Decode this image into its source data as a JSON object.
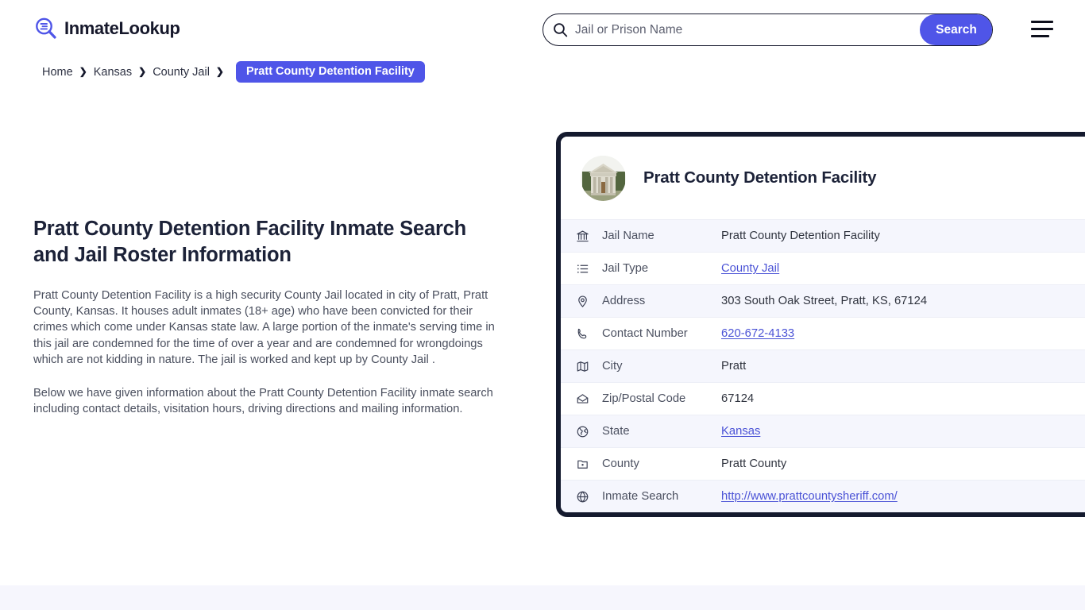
{
  "header": {
    "logo_text": "InmateLookup",
    "logo_icon": "magnifier-list-icon",
    "search_placeholder": "Jail or Prison Name",
    "search_value": "",
    "search_button_label": "Search",
    "search_icon": "search-icon",
    "menu_icon": "hamburger-menu-icon"
  },
  "breadcrumb": {
    "items": [
      {
        "label": "Home"
      },
      {
        "label": "Kansas"
      },
      {
        "label": "County Jail"
      }
    ],
    "separator": "❯",
    "current": "Pratt County Detention Facility"
  },
  "main": {
    "title": "Pratt County Detention Facility Inmate Search and Jail Roster Information",
    "paragraph_1": "Pratt County Detention Facility is a high security County Jail located in city of Pratt, Pratt County, Kansas. It houses adult inmates (18+ age) who have been convicted for their crimes which come under Kansas state law. A large portion of the inmate's serving time in this jail are condemned for the time of over a year and are condemned for wrongdoings which are not kidding in nature. The jail is worked and kept up by County Jail .",
    "paragraph_2": "Below we have given information about the Pratt County Detention Facility inmate search including contact details, visitation hours, driving directions and mailing information."
  },
  "info_card": {
    "avatar_icon": "courthouse-photo",
    "title": "Pratt County Detention Facility",
    "rows": [
      {
        "icon": "bank-icon",
        "label": "Jail Name",
        "value": "Pratt County Detention Facility",
        "link": false
      },
      {
        "icon": "list-icon",
        "label": "Jail Type",
        "value": "County Jail",
        "link": true
      },
      {
        "icon": "map-pin-icon",
        "label": "Address",
        "value": "303 South Oak Street, Pratt, KS, 67124",
        "link": false
      },
      {
        "icon": "phone-icon",
        "label": "Contact Number",
        "value": "620-672-4133",
        "link": true
      },
      {
        "icon": "map-icon",
        "label": "City",
        "value": "Pratt",
        "link": false
      },
      {
        "icon": "envelope-icon",
        "label": "Zip/Postal Code",
        "value": "67124",
        "link": false
      },
      {
        "icon": "globe-americas-icon",
        "label": "State",
        "value": "Kansas",
        "link": true
      },
      {
        "icon": "county-icon",
        "label": "County",
        "value": "Pratt County",
        "link": false
      },
      {
        "icon": "globe-icon",
        "label": "Inmate Search",
        "value": "http://www.prattcountysheriff.com/",
        "link": true
      }
    ]
  },
  "colors": {
    "accent": "#4f55e8",
    "card_border": "#141a2e",
    "row_tint": "#f5f6fd",
    "link": "#4a52d6",
    "bottom_band": "#f6f6fd"
  }
}
